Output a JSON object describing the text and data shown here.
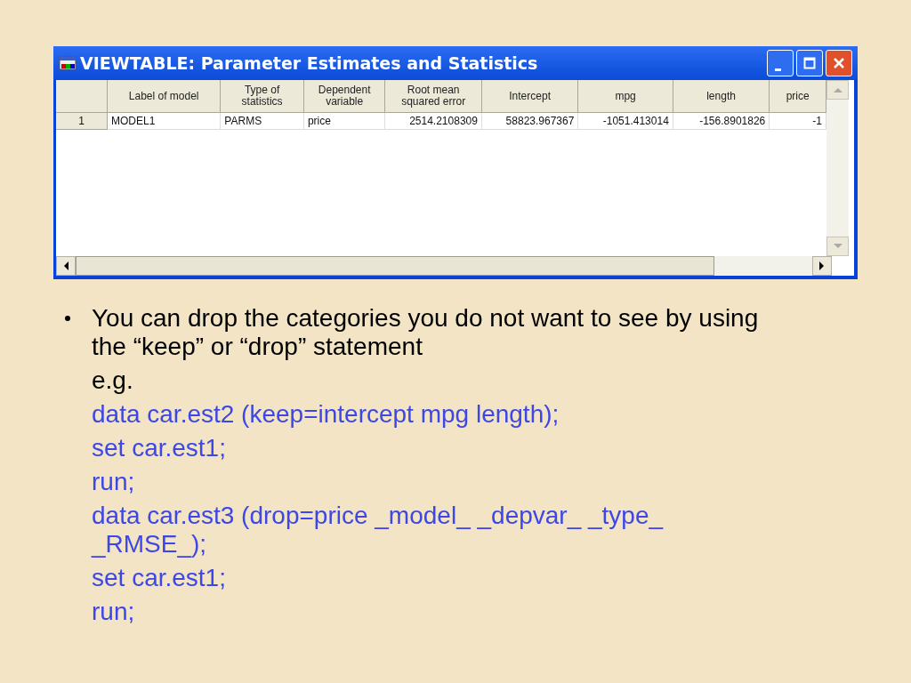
{
  "window": {
    "title": "VIEWTABLE: Parameter Estimates and Statistics"
  },
  "table": {
    "columns": [
      "Label of model",
      "Type of statistics",
      "Dependent variable",
      "Root mean squared error",
      "Intercept",
      "mpg",
      "length",
      "price"
    ],
    "rows": [
      {
        "number": "1",
        "cells": [
          "MODEL1",
          "PARMS",
          "price",
          "2514.2108309",
          "58823.967367",
          "-1051.413014",
          "-156.8901826",
          "-1"
        ]
      }
    ]
  },
  "bullet": {
    "text": "You can drop the categories you do not want to see by using the “keep” or “drop” statement",
    "example_label": "e.g.",
    "code_lines": [
      "data car.est2 (keep=intercept mpg length);",
      "set car.est1;",
      "run;",
      "data car.est3 (drop=price _model_ _depvar_ _type_ _RMSE_);",
      "set car.est1;",
      "run;"
    ]
  }
}
